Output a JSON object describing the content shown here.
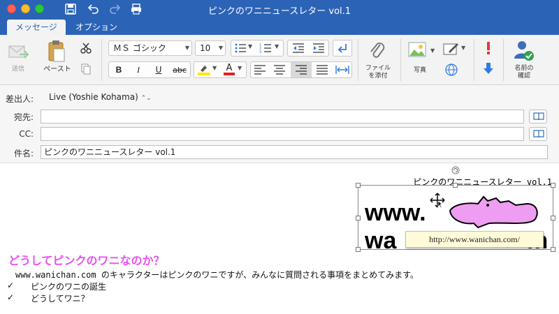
{
  "window": {
    "title": "ピンクのワニニュースレター vol.1"
  },
  "tabs": [
    {
      "label": "メッセージ",
      "active": true
    },
    {
      "label": "オプション",
      "active": false
    }
  ],
  "ribbon": {
    "send_label": "送信",
    "paste_label": "ペースト",
    "font_name": "ＭＳ ゴシック",
    "font_size": "10",
    "attach_label_1": "ファイル",
    "attach_label_2": "を添付",
    "picture_label": "写真",
    "check_names_label_1": "名前の",
    "check_names_label_2": "確認",
    "bold": "B",
    "italic": "I",
    "underline": "U",
    "strike": "abc",
    "text_color_label": "A"
  },
  "header": {
    "from_label": "差出人:",
    "from_value": "Live (Yoshie Kohama)",
    "to_label": "宛先:",
    "to_value": "",
    "cc_label": "CC:",
    "cc_value": "",
    "subject_label": "件名:",
    "subject_value": "ピンクのワニニュースレター vol.1"
  },
  "body": {
    "newsletter_title": "ピンクのワニニュースレター vol.1",
    "logo_line1": "www.",
    "logo_line2a": "wa",
    "logo_line2b": "m",
    "tooltip": "http://www.wanichan.com/",
    "heading": "どうしてピンクのワニなのか？",
    "intro": "www.wanichan.com のキャラクターはピンクのワニですが、みんなに質問される事項をまとめてみます。",
    "bullets": [
      "ピンクのワニの誕生",
      "どうしてワニ？"
    ],
    "bullet_mark": "✓"
  },
  "colors": {
    "titlebar": "#2b63b6",
    "heading_pink": "#e84ff0",
    "croc_pink": "#ee9df2",
    "highlight_yellow": "#ffe800",
    "font_red": "#e02020",
    "important_red": "#e53935",
    "low_blue": "#2f7de1"
  }
}
